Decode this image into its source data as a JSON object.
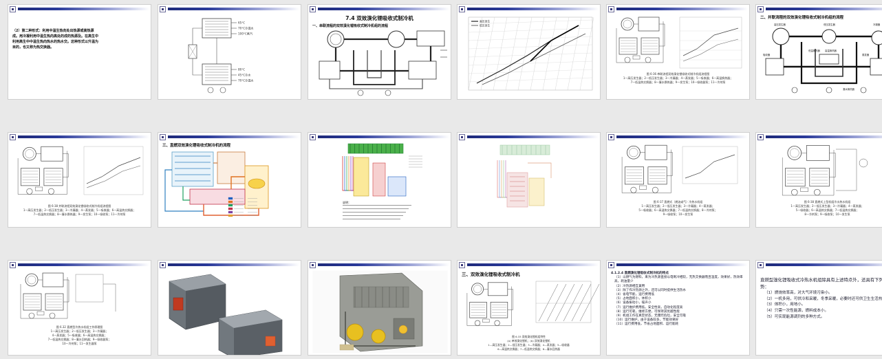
{
  "slides": [
    {
      "id": 1,
      "texts": [
        "（2）第二种形式：利用中温生热向处出热源或高热源",
        "成。用冷凝利用中温生热向高处的成的热源及。在高生中",
        "利用高生中中温生热向热水的热水交。这种形式以升温为",
        "目的，也又称为热交换器。"
      ]
    },
    {
      "id": 2,
      "labels": [
        "65℃",
        "70℃冷温水",
        "100℃蒸汽",
        "80℃",
        "45℃冷水",
        "70℃冷温水"
      ]
    },
    {
      "id": 3,
      "title": "7.4 双效溴化锂吸收式制冷机",
      "subtitle": "一、串联流程的双效溴化锂吸收式制冷机组的流程"
    },
    {
      "id": 4,
      "legend": [
        "高压发生",
        "低压发生"
      ]
    },
    {
      "id": 5,
      "caption": [
        "图 6-36  串联流程双效溴化锂吸收式制冷机组流程图",
        "1—高压发生器；2—低压发生器；3—冷凝器；4—蒸发器；5—吸收器；6—高温换热器；",
        "7—低温热交换器；8—凝水换热器；9—发生泵；10—吸收器泵；11—冷剂泵"
      ]
    },
    {
      "id": 6,
      "title": "二、并联流程的双效溴化锂吸收式制冷机组的流程",
      "labels": [
        "高压发生器",
        "低压发生器",
        "冷凝器",
        "蒸发器",
        "吸收器",
        "低温换热器",
        "高温换热器",
        "凝水换热器"
      ]
    },
    {
      "id": 7,
      "caption": [
        "图 6-38  并联流程双效溴化锂吸收式制冷机组流程图",
        "1—高压发生器；2—低压发生器；3—冷凝器；4—蒸发器；5—吸收器；6—高温热交换器；",
        "7—低温热交换器；8—凝水换热器；9—发生泵；10—吸收泵；11—冷剂泵"
      ]
    },
    {
      "id": 8,
      "title": "三、直燃双效溴化锂吸收式制冷机的流程"
    },
    {
      "id": 9,
      "notes": [
        "说明："
      ]
    },
    {
      "id": 10
    },
    {
      "id": 11,
      "caption": [
        "图 6-37  直燃式（燃油或气）冷热水机组",
        "1—高压发生器；2—低压发生器；3—冷凝器；4—蒸发器；",
        "5—吸收器；6—高温热交换器；7—低温热交换器；8—冷剂泵；",
        "9—吸收泵；10—发生泵"
      ]
    },
    {
      "id": 12,
      "caption": [
        "图 6-38  直燃式上型机组冷水热水机组",
        "1—高压发生器；2—低压发生器；3—冷凝器；4—蒸发器；",
        "5—吸收器；6—高温热交换器；7—低温热交换器；",
        "8—冷剂泵；9—吸收泵；10—发生泵"
      ]
    },
    {
      "id": 13,
      "caption": [
        "图 6.32  直燃型冷热水机组工作原理图",
        "1—高压发生器；2—低压发生器；3—冷凝器；",
        "4—蒸发器；5—吸收器；6—高温热交换器；",
        "7—低温热交换器；8—凝水回热器；9—吸收器泵；",
        "10—冷剂泵；11—发生器泵"
      ]
    },
    {
      "id": 14
    },
    {
      "id": 15
    },
    {
      "id": 16,
      "title": "三、双效溴化锂吸收式制冷机",
      "caption": [
        "图 6.33  双效溴化锂机组特性",
        "(a) 单效溴化锂机；(b) 双效溴化锂机",
        "1—高压发生器；2—低压发生器；3—冷凝器；4—蒸发器；5—吸收器",
        "6—高温热交换器；7—低温热交换器；8—凝水回热器"
      ]
    },
    {
      "id": 17,
      "bullets": [
        "4.1.2.4  直燃溴化锂吸收式制冷机的特点",
        "（1）以燃气为燃料，来为冷热源直接以电制冷相较，无热交换器而且温度，效果好，热效率高，耗油量少",
        "（2）冷热源相互兼用",
        "（3）除了作冷热源之外，还可以同时提供生活热水",
        "（4）省电节能，运行费用低",
        "（5）占地面积小，体积小",
        "（6）设备振动小，噪声小",
        "（7）运行维护费用低，安全性高，自动化程度高",
        "（8）运行可靠，维修方便，可保持其优越性能",
        "（9）机组工作在真空状态，无爆炸危险，安全可靠",
        "（10）运行维护，由于设备较多，节能效果好",
        "（11）运行费用低，节省占地面积、运行能耗"
      ]
    },
    {
      "id": 18,
      "bullets": [
        "直燃型溴化锂吸收式冷热水机组除具有上述特点外，还具有下列优势：",
        "（1）燃烧效率高，对大气环境污染小。",
        "（2）一机多用，可供冷和采暖，冬季采暖，必要时还可供卫生生活热水。",
        "（3）体积小，用地小。",
        "（4）只需一次性能源，燃料成本小。",
        "（5）可实现能源调剂的多种方式。"
      ]
    }
  ],
  "colors": {
    "bg": "#e9e9e9",
    "slide_bg": "#ffffff",
    "header_dark": "#1e2a7a",
    "bullet_text": "#223344"
  }
}
